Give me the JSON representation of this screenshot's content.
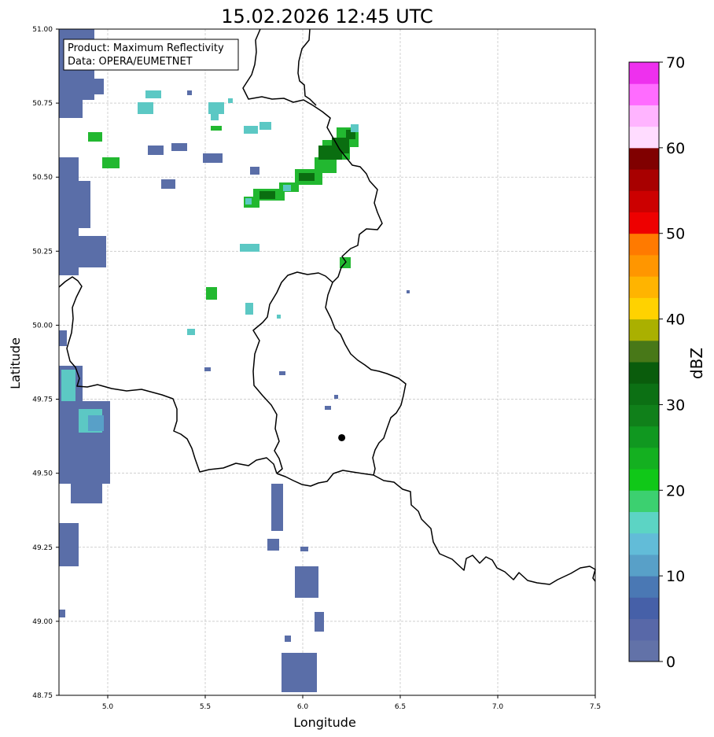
{
  "title": "15.02.2026 12:45 UTC",
  "info_box": {
    "line1": "Product: Maximum Reflectivity",
    "line2": "Data: OPERA/EUMETNET"
  },
  "axes": {
    "xlabel": "Longitude",
    "ylabel": "Latitude",
    "xlim": [
      4.75,
      7.5
    ],
    "ylim": [
      48.75,
      51.0
    ],
    "xticks": [
      "5.0",
      "5.5",
      "6.0",
      "6.5",
      "7.0",
      "7.5"
    ],
    "yticks": [
      "48.75",
      "49.00",
      "49.25",
      "49.50",
      "49.75",
      "50.00",
      "50.25",
      "50.50",
      "50.75",
      "51.00"
    ],
    "grid": "on"
  },
  "colorbar": {
    "label": "dBZ",
    "ticks": [
      "0",
      "10",
      "20",
      "30",
      "40",
      "50",
      "60",
      "70"
    ],
    "range": [
      0,
      70
    ],
    "colors": [
      "#6272a8",
      "#5868a8",
      "#4660a8",
      "#4a78b4",
      "#58a0c8",
      "#62bcd8",
      "#5cd4c4",
      "#3cd070",
      "#10c818",
      "#14b020",
      "#109820",
      "#10801a",
      "#0c7014",
      "#0a5c0c",
      "#487818",
      "#aab000",
      "#ffd200",
      "#ffb400",
      "#ff9600",
      "#ff7a00",
      "#ee0000",
      "#cc0000",
      "#a80000",
      "#800000",
      "#ffdcff",
      "#ffb4ff",
      "#ff6cff",
      "#ee30ee"
    ]
  },
  "marker": {
    "name": "city point",
    "lon": 6.2,
    "lat": 49.62
  },
  "legend_colors": {
    "weak": "#5a6ea8",
    "light": "#5cc8c4",
    "moderate": "#22b830",
    "strong": "#0a6e10"
  }
}
